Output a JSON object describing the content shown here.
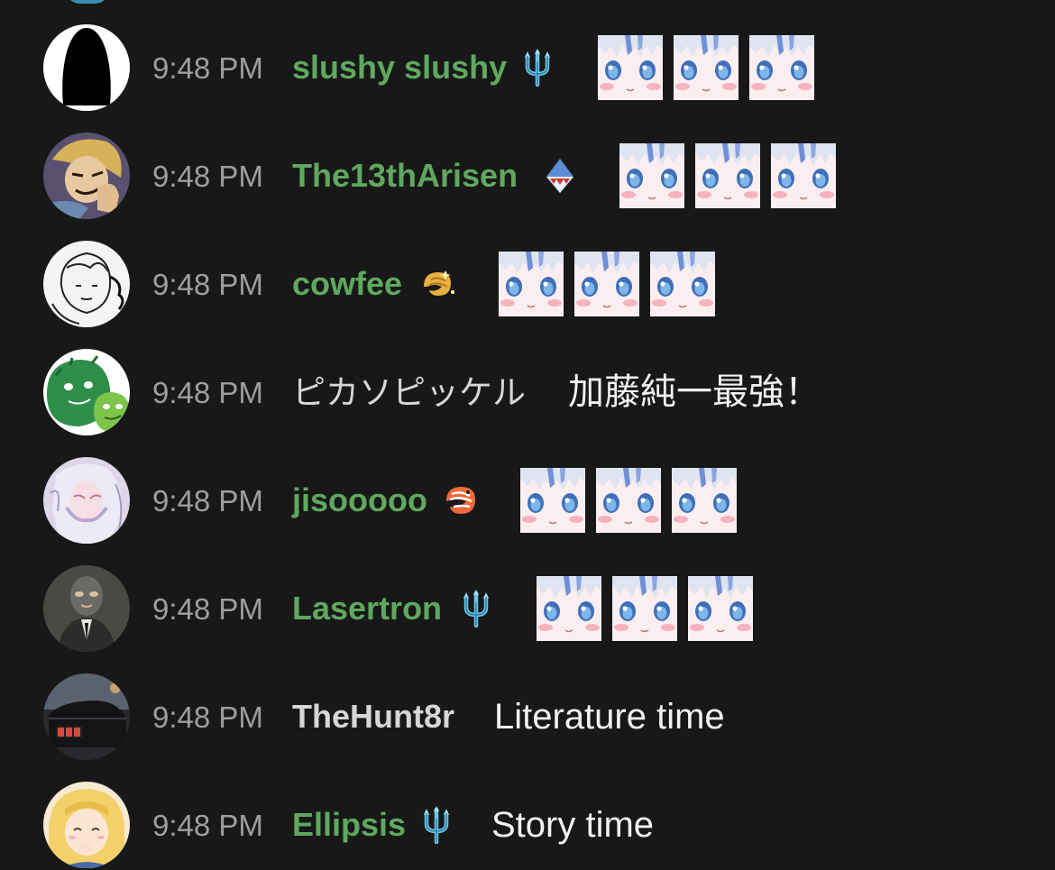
{
  "messages": [
    {
      "time": "9:48 PM",
      "username": "slushy slushy",
      "badge": "trident-icon",
      "emotes": [
        "gura-face-emote",
        "gura-face-emote",
        "gura-face-emote"
      ],
      "text": ""
    },
    {
      "time": "9:48 PM",
      "username": "The13thArisen",
      "badge": "shark-fin-icon",
      "emotes": [
        "gura-face-emote",
        "gura-face-emote",
        "gura-face-emote"
      ],
      "text": ""
    },
    {
      "time": "9:48 PM",
      "username": "cowfee",
      "badge": "golden-shrimp-icon",
      "emotes": [
        "gura-face-emote",
        "gura-face-emote",
        "gura-face-emote"
      ],
      "text": ""
    },
    {
      "time": "9:48 PM",
      "username": "ピカソピッケル",
      "badge": "",
      "emotes": [],
      "text": "加藤純一最強！"
    },
    {
      "time": "9:48 PM",
      "username": "jisooooo",
      "badge": "shrimp-icon",
      "emotes": [
        "gura-face-emote",
        "gura-face-emote",
        "gura-face-emote"
      ],
      "text": ""
    },
    {
      "time": "9:48 PM",
      "username": "Lasertron",
      "badge": "trident-icon",
      "emotes": [
        "gura-face-emote",
        "gura-face-emote",
        "gura-face-emote"
      ],
      "text": ""
    },
    {
      "time": "9:48 PM",
      "username": "TheHunt8r",
      "badge": "",
      "emotes": [],
      "text": "Literature time"
    },
    {
      "time": "9:48 PM",
      "username": "Ellipsis",
      "badge": "trident-icon",
      "emotes": [],
      "text": "Story time"
    }
  ],
  "colors": {
    "background": "#181818",
    "member_name": "#5fa85f",
    "plain_name": "#d6d6d6",
    "timestamp": "#9e9e9e",
    "message_text": "#f2f2f2"
  }
}
